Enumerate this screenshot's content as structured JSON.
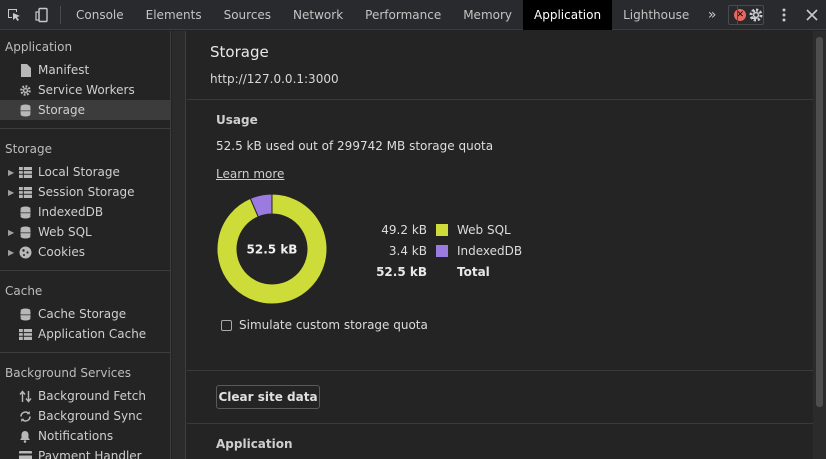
{
  "toolbar": {
    "tabs": [
      "Console",
      "Elements",
      "Sources",
      "Network",
      "Performance",
      "Memory",
      "Application",
      "Lighthouse"
    ],
    "active_tab": "Application",
    "more_icon": "»",
    "error_count": "1"
  },
  "sidebar": {
    "sections": [
      {
        "title": "Application",
        "items": [
          {
            "label": "Manifest",
            "icon": "file-icon"
          },
          {
            "label": "Service Workers",
            "icon": "gear-icon"
          },
          {
            "label": "Storage",
            "icon": "database-icon",
            "selected": true
          }
        ]
      },
      {
        "title": "Storage",
        "items": [
          {
            "label": "Local Storage",
            "icon": "grid-icon",
            "expandable": true
          },
          {
            "label": "Session Storage",
            "icon": "grid-icon",
            "expandable": true
          },
          {
            "label": "IndexedDB",
            "icon": "database-icon"
          },
          {
            "label": "Web SQL",
            "icon": "database-icon",
            "expandable": true
          },
          {
            "label": "Cookies",
            "icon": "cookie-icon",
            "expandable": true
          }
        ]
      },
      {
        "title": "Cache",
        "items": [
          {
            "label": "Cache Storage",
            "icon": "database-icon"
          },
          {
            "label": "Application Cache",
            "icon": "grid-icon"
          }
        ]
      },
      {
        "title": "Background Services",
        "items": [
          {
            "label": "Background Fetch",
            "icon": "fetch-icon"
          },
          {
            "label": "Background Sync",
            "icon": "sync-icon"
          },
          {
            "label": "Notifications",
            "icon": "bell-icon"
          },
          {
            "label": "Payment Handler",
            "icon": "payment-icon"
          }
        ]
      }
    ]
  },
  "main": {
    "title": "Storage",
    "origin": "http://127.0.0.1:3000",
    "usage": {
      "heading": "Usage",
      "summary": "52.5 kB used out of 299742 MB storage quota",
      "learn_more": "Learn more",
      "total_label": "52.5 kB",
      "breakdown": [
        {
          "value": "49.2 kB",
          "name": "Web SQL",
          "color": "#cddc39",
          "bytes": 49.2
        },
        {
          "value": "3.4 kB",
          "name": "IndexedDB",
          "color": "#9c7be0",
          "bytes": 3.4
        }
      ],
      "total_row": {
        "value": "52.5 kB",
        "name": "Total"
      },
      "simulate_label": "Simulate custom storage quota"
    },
    "clear_button": "Clear site data",
    "application_heading": "Application"
  },
  "colors": {
    "web_sql": "#cddc39",
    "indexeddb": "#9c7be0",
    "active_tab_bg": "#000000"
  }
}
